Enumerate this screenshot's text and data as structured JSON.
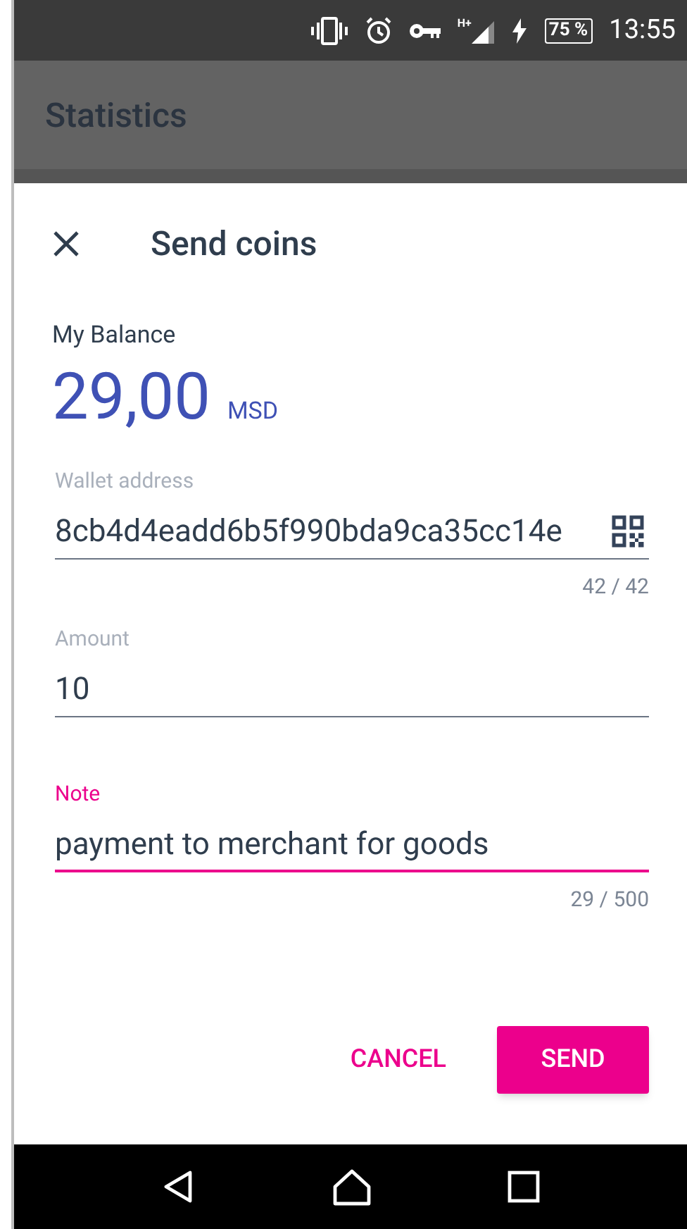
{
  "status_bar": {
    "network": "H+",
    "battery": "75 %",
    "time": "13:55"
  },
  "app_bar": {
    "title": "Statistics"
  },
  "dialog": {
    "title": "Send coins",
    "balance_label": "My Balance",
    "balance": "29,00",
    "currency": "MSD",
    "fields": [
      {
        "kind": "qr",
        "label": "Wallet address",
        "value": "8cb4d4eadd6b5f990bda9ca35cc14e",
        "counter": "42 / 42",
        "focused": false
      },
      {
        "kind": "text",
        "label": "Amount",
        "value": "10",
        "focused": false
      },
      {
        "kind": "text",
        "label": "Note",
        "value": "payment to merchant for goods",
        "counter": "29 / 500",
        "focused": true
      }
    ],
    "buttons": [
      {
        "kind": "flat",
        "label": "CANCEL"
      },
      {
        "kind": "raised",
        "label": "SEND"
      }
    ]
  }
}
